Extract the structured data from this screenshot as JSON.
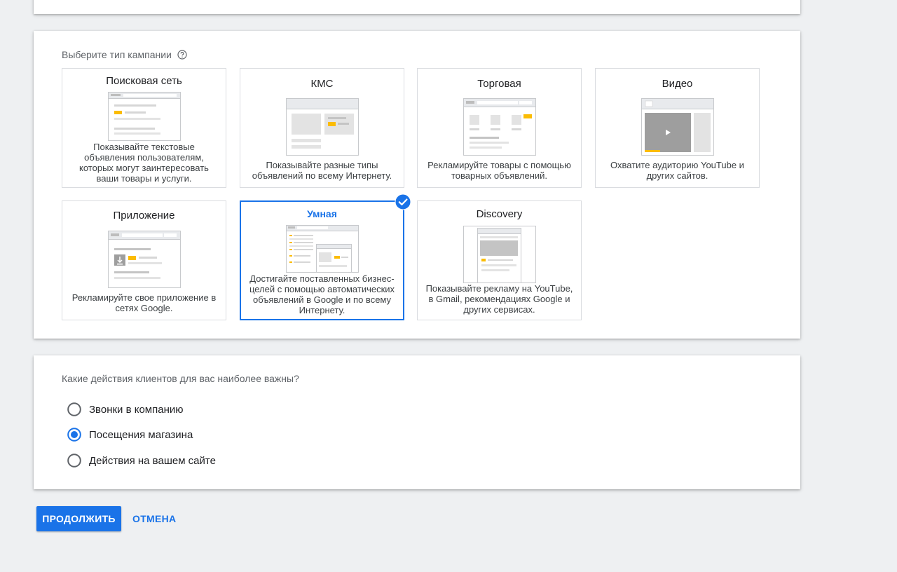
{
  "campaign_type": {
    "label": "Выберите тип кампании",
    "tiles": [
      {
        "title": "Поисковая сеть",
        "desc": "Показывайте текстовые объявления пользователям, которых могут заинтересовать ваши товары и услуги.",
        "selected": false
      },
      {
        "title": "КМС",
        "desc": "Показывайте разные типы объявлений по всему Интернету.",
        "selected": false
      },
      {
        "title": "Торговая",
        "desc": "Рекламируйте товары с помощью товарных объявлений.",
        "selected": false
      },
      {
        "title": "Видео",
        "desc": "Охватите аудиторию YouTube и других сайтов.",
        "selected": false
      },
      {
        "title": "Приложение",
        "desc": "Рекламируйте свое приложение в сетях Google.",
        "selected": false
      },
      {
        "title": "Умная",
        "desc": "Достигайте поставленных бизнес-целей с помощью автоматических объявлений в Google и по всему Интернету.",
        "selected": true
      },
      {
        "title": "Discovery",
        "desc": "Показывайте рекламу на YouTube, в Gmail, рекомендациях Google и других сервисах.",
        "selected": false
      }
    ]
  },
  "goals": {
    "label": "Какие действия клиентов для вас наиболее важны?",
    "options": [
      {
        "label": "Звонки в компанию",
        "checked": false
      },
      {
        "label": "Посещения магазина",
        "checked": true
      },
      {
        "label": "Действия на вашем сайте",
        "checked": false
      }
    ]
  },
  "actions": {
    "continue_label": "ПРОДОЛЖИТЬ",
    "cancel_label": "ОТМЕНА"
  },
  "colors": {
    "accent": "#1a73e8",
    "highlight": "#fbbc04"
  }
}
